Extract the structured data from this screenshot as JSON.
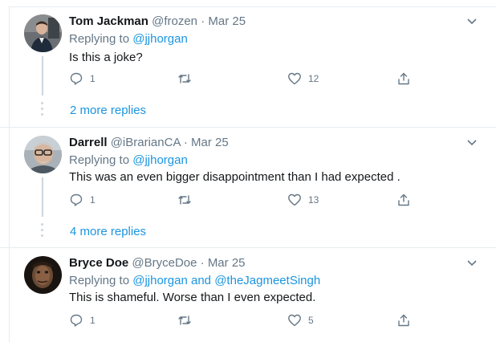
{
  "tweets": [
    {
      "name": "Tom Jackman",
      "handle": "@frozen",
      "separator": "·",
      "date": "Mar 25",
      "replying_prefix": "Replying to ",
      "mentions": [
        "@jjhorgan"
      ],
      "mention_joiner": "",
      "text": "Is this a joke?",
      "replies": "1",
      "retweets": "",
      "likes": "12",
      "more_replies": "2 more replies"
    },
    {
      "name": "Darrell",
      "handle": "@iBrarianCA",
      "separator": "·",
      "date": "Mar 25",
      "replying_prefix": "Replying to ",
      "mentions": [
        "@jjhorgan"
      ],
      "mention_joiner": "",
      "text": "This was an even bigger disappointment than I had expected .",
      "replies": "1",
      "retweets": "",
      "likes": "13",
      "more_replies": "4 more replies"
    },
    {
      "name": "Bryce Doe",
      "handle": "@BryceDoe",
      "separator": "·",
      "date": "Mar 25",
      "replying_prefix": "Replying to ",
      "mentions": [
        "@jjhorgan",
        "@theJagmeetSingh"
      ],
      "mention_joiner": " and ",
      "text": "This is shameful. Worse than I even expected.",
      "replies": "1",
      "retweets": "",
      "likes": "5",
      "more_replies": ""
    }
  ],
  "icons": {
    "reply": "reply-icon",
    "retweet": "retweet-icon",
    "like": "heart-icon",
    "share": "share-icon",
    "more": "chevron-down-icon"
  },
  "colors": {
    "link": "#1b95e0",
    "muted": "#657786",
    "border": "#e6ecf0",
    "thread": "#ccd6dd"
  }
}
